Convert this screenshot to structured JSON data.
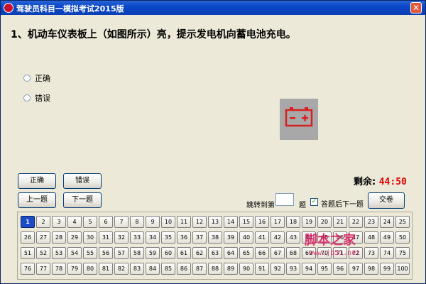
{
  "window": {
    "title": "驾驶员科目一模拟考试2015版",
    "close_label": "✕"
  },
  "question": {
    "text": "1、机动车仪表板上（如图所示）亮，提示发电机向蓄电池充电。"
  },
  "options": [
    {
      "label": "正确",
      "selected": false
    },
    {
      "label": "错误",
      "selected": false
    }
  ],
  "figure": {
    "icon": "battery-warning-icon",
    "icon_color": "#d92020",
    "background": "#a8a8a8"
  },
  "buttons": {
    "correct": "正确",
    "wrong": "错误",
    "prev": "上一题",
    "next": "下一题",
    "submit": "交卷"
  },
  "timer": {
    "label": "剩余:",
    "value": "44:50",
    "color": "#e00000"
  },
  "jump": {
    "prefix": "跳转到第",
    "suffix": "题",
    "value": ""
  },
  "auto_next": {
    "label": "答题后下一题",
    "checked": true
  },
  "question_numbers": {
    "count": 100,
    "current": 1,
    "active_color": "#1e4cc8"
  },
  "watermark": {
    "text": "脚本之家",
    "url": "www.jb51.net"
  }
}
